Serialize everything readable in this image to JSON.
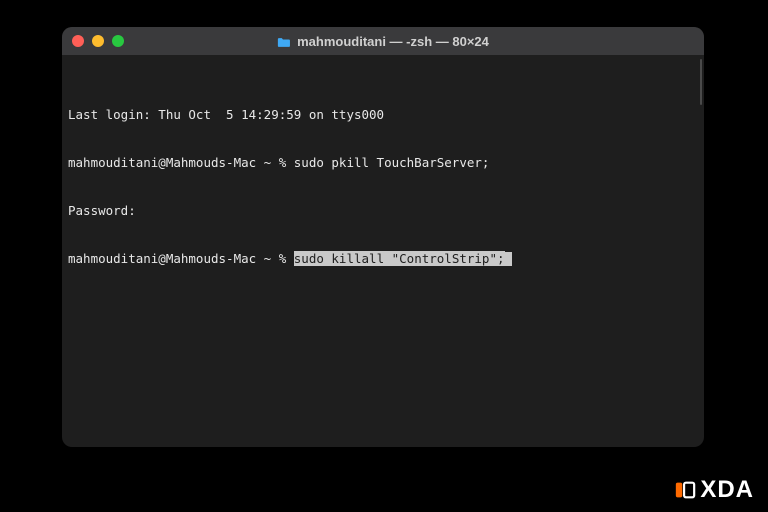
{
  "window": {
    "title": "mahmouditani — -zsh — 80×24"
  },
  "colors": {
    "close": "#ff5f57",
    "minimize": "#febc2e",
    "maximize": "#28c840",
    "bg": "#1e1e1e",
    "titlebar": "#3a3a3c",
    "text": "#e8e8e8",
    "selection_bg": "#c9c9c9",
    "selection_fg": "#1e1e1e"
  },
  "terminal": {
    "lines": [
      {
        "prefix": "Last login: Thu Oct  5 14:29:59 on ttys000",
        "selected": ""
      },
      {
        "prefix": "mahmouditani@Mahmouds-Mac ~ % sudo pkill TouchBarServer;",
        "selected": ""
      },
      {
        "prefix": "Password:",
        "selected": ""
      },
      {
        "prefix": "mahmouditani@Mahmouds-Mac ~ % ",
        "selected": "sudo killall \"ControlStrip\";"
      }
    ]
  },
  "watermark": {
    "text": "XDA"
  }
}
